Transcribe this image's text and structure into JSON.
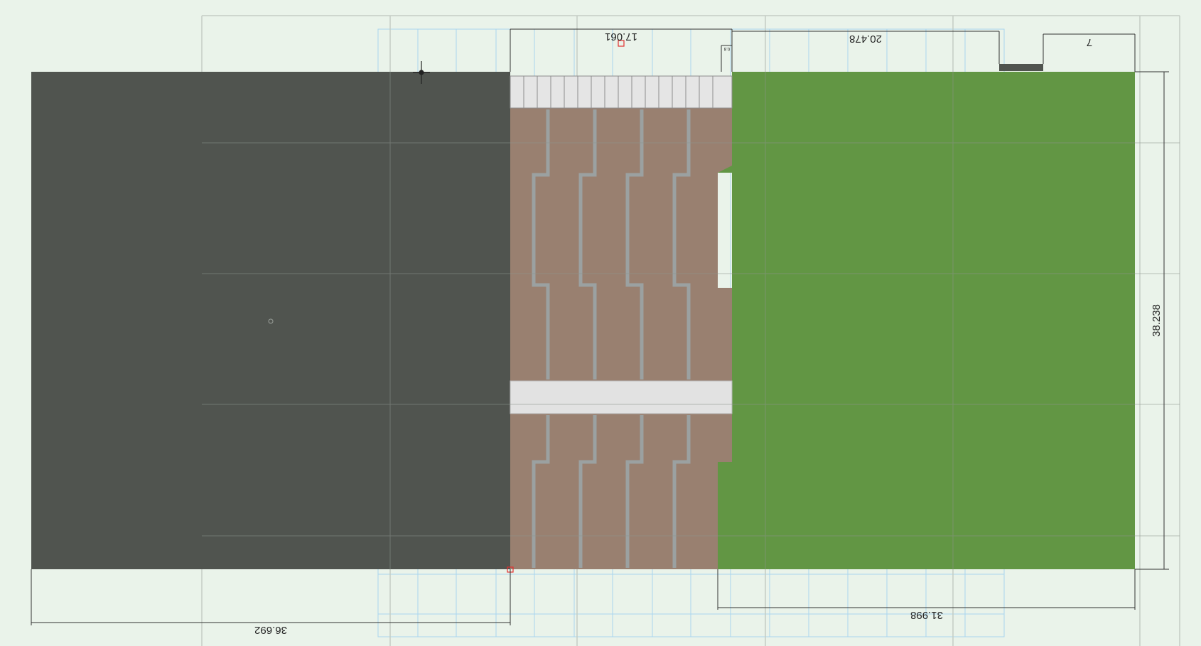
{
  "dimensions": {
    "top_deck_width": "17.061",
    "top_right_width": "20.478",
    "top_far_right_width": "7",
    "top_small_gap": "0.8",
    "right_height": "38.238",
    "bottom_left_width": "36.692",
    "bottom_right_width": "31.998"
  },
  "colors": {
    "background": "#eaf3ea",
    "pavement": "#50544f",
    "deck": "#998070",
    "deck_gap": "#8c9291",
    "walkway": "#e2e2e2",
    "lawn": "#629644",
    "grid_gray": "#c4cdc4",
    "grid_blue": "#a9d6ef",
    "dim_line": "#333333",
    "marker_red": "#e03030"
  }
}
